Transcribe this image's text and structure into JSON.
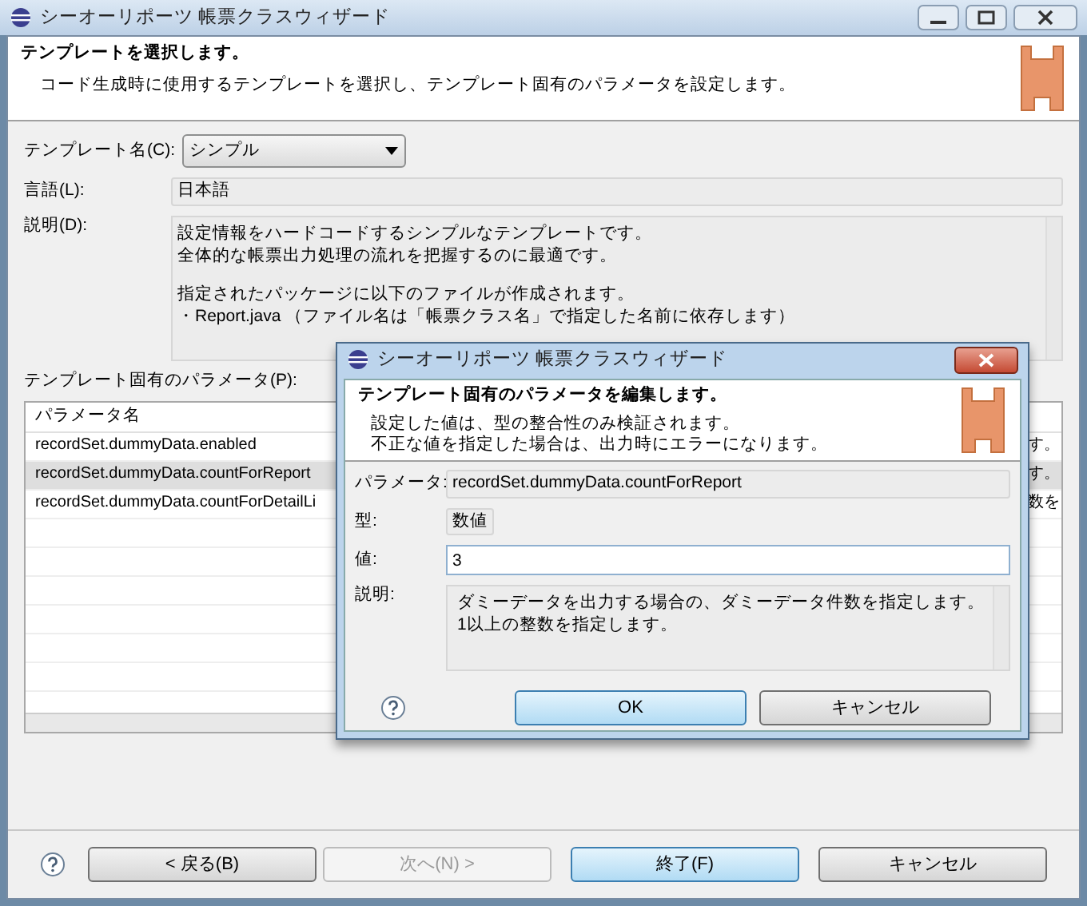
{
  "window": {
    "title": "シーオーリポーツ 帳票クラスウィザード"
  },
  "header": {
    "title": "テンプレートを選択します。",
    "message": "コード生成時に使用するテンプレートを選択し、テンプレート固有のパラメータを設定します。"
  },
  "form": {
    "template": {
      "label": "テンプレート名(C):",
      "value": "シンプル"
    },
    "language": {
      "label": "言語(L):",
      "value": "日本語"
    },
    "description": {
      "label": "説明(D):",
      "paragraphs": [
        [
          "設定情報をハードコードするシンプルなテンプレートです。",
          "全体的な帳票出力処理の流れを把握するのに最適です。"
        ],
        [
          "指定されたパッケージに以下のファイルが作成されます。",
          "・Report.java （ファイル名は「帳票クラス名」で指定した名前に依存します）"
        ]
      ]
    }
  },
  "parameters": {
    "label": "テンプレート固有のパラメータ(P):",
    "columns": [
      "パラメータ名"
    ],
    "rows": [
      {
        "name": "recordSet.dummyData.enabled",
        "column_2": "す。",
        "selected": false
      },
      {
        "name": "recordSet.dummyData.countForReport",
        "column_2": "す。",
        "selected": true
      },
      {
        "name": "recordSet.dummyData.countForDetailLi",
        "column_2": "数を",
        "selected": false
      }
    ]
  },
  "buttons": [
    {
      "label": "< 戻る(B)",
      "disabled": false,
      "default": false
    },
    {
      "label": "次へ(N) >",
      "disabled": true,
      "default": false
    },
    {
      "label": "終了(F)",
      "disabled": false,
      "default": true
    },
    {
      "label": "キャンセル",
      "disabled": false,
      "default": false
    }
  ],
  "dialog": {
    "title": "シーオーリポーツ 帳票クラスウィザード",
    "header": {
      "title": "テンプレート固有のパラメータを編集します。",
      "lines": [
        "設定した値は、型の整合性のみ検証されます。",
        "不正な値を指定した場合は、出力時にエラーになります。"
      ]
    },
    "parameter": {
      "label": "パラメータ:",
      "value": "recordSet.dummyData.countForReport"
    },
    "type": {
      "label": "型:",
      "value": "数値"
    },
    "value": {
      "label": "値:",
      "value": "3"
    },
    "description": {
      "label": "説明:",
      "lines": [
        "ダミーデータを出力する場合の、ダミーデータ件数を指定します。",
        "1以上の整数を指定します。"
      ]
    },
    "buttons": [
      {
        "label": "OK",
        "disabled": false,
        "default": true
      },
      {
        "label": "キャンセル",
        "disabled": false,
        "default": false
      }
    ]
  }
}
